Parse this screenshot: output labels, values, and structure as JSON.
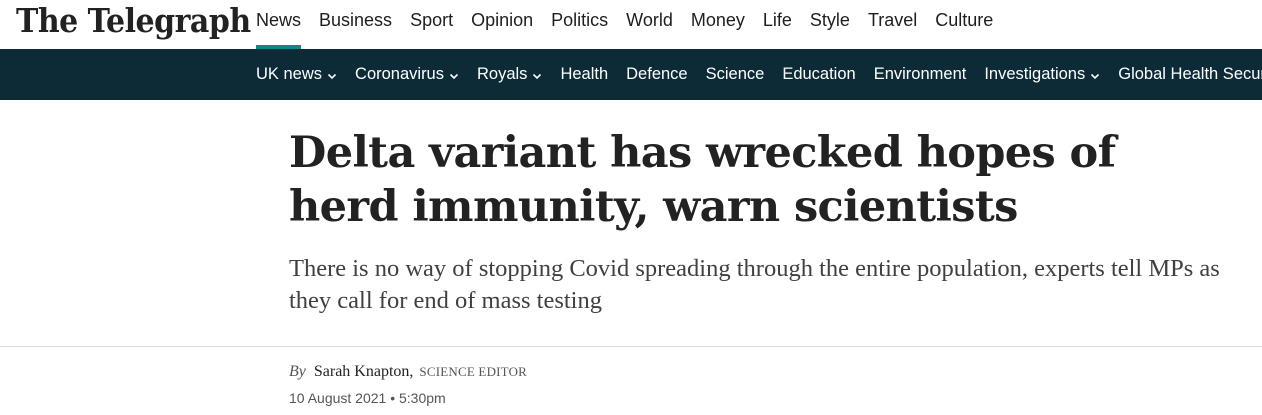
{
  "masthead": {
    "logo_text": "The Telegraph",
    "primary_nav": [
      {
        "label": "News",
        "active": true
      },
      {
        "label": "Business",
        "active": false
      },
      {
        "label": "Sport",
        "active": false
      },
      {
        "label": "Opinion",
        "active": false
      },
      {
        "label": "Politics",
        "active": false
      },
      {
        "label": "World",
        "active": false
      },
      {
        "label": "Money",
        "active": false
      },
      {
        "label": "Life",
        "active": false
      },
      {
        "label": "Style",
        "active": false
      },
      {
        "label": "Travel",
        "active": false
      },
      {
        "label": "Culture",
        "active": false
      }
    ],
    "accent_color": "#0a8a8b"
  },
  "subnav": {
    "background_color": "#0c2b36",
    "items": [
      {
        "label": "UK news",
        "has_dropdown": true
      },
      {
        "label": "Coronavirus",
        "has_dropdown": true
      },
      {
        "label": "Royals",
        "has_dropdown": true
      },
      {
        "label": "Health",
        "has_dropdown": false
      },
      {
        "label": "Defence",
        "has_dropdown": false
      },
      {
        "label": "Science",
        "has_dropdown": false
      },
      {
        "label": "Education",
        "has_dropdown": false
      },
      {
        "label": "Environment",
        "has_dropdown": false
      },
      {
        "label": "Investigations",
        "has_dropdown": true
      },
      {
        "label": "Global Health Security",
        "has_dropdown": false
      }
    ],
    "dropdown_icon": "chevron-down-icon"
  },
  "article": {
    "headline": "Delta variant has wrecked hopes of herd immunity, warn scientists",
    "standfirst": "There is no way of stopping Covid spreading through the entire population, experts tell MPs as they call for end of mass testing",
    "byline": {
      "by": "By",
      "author": "Sarah Knapton,",
      "role": "SCIENCE EDITOR"
    },
    "date": "10 August 2021 • 5:30pm"
  }
}
